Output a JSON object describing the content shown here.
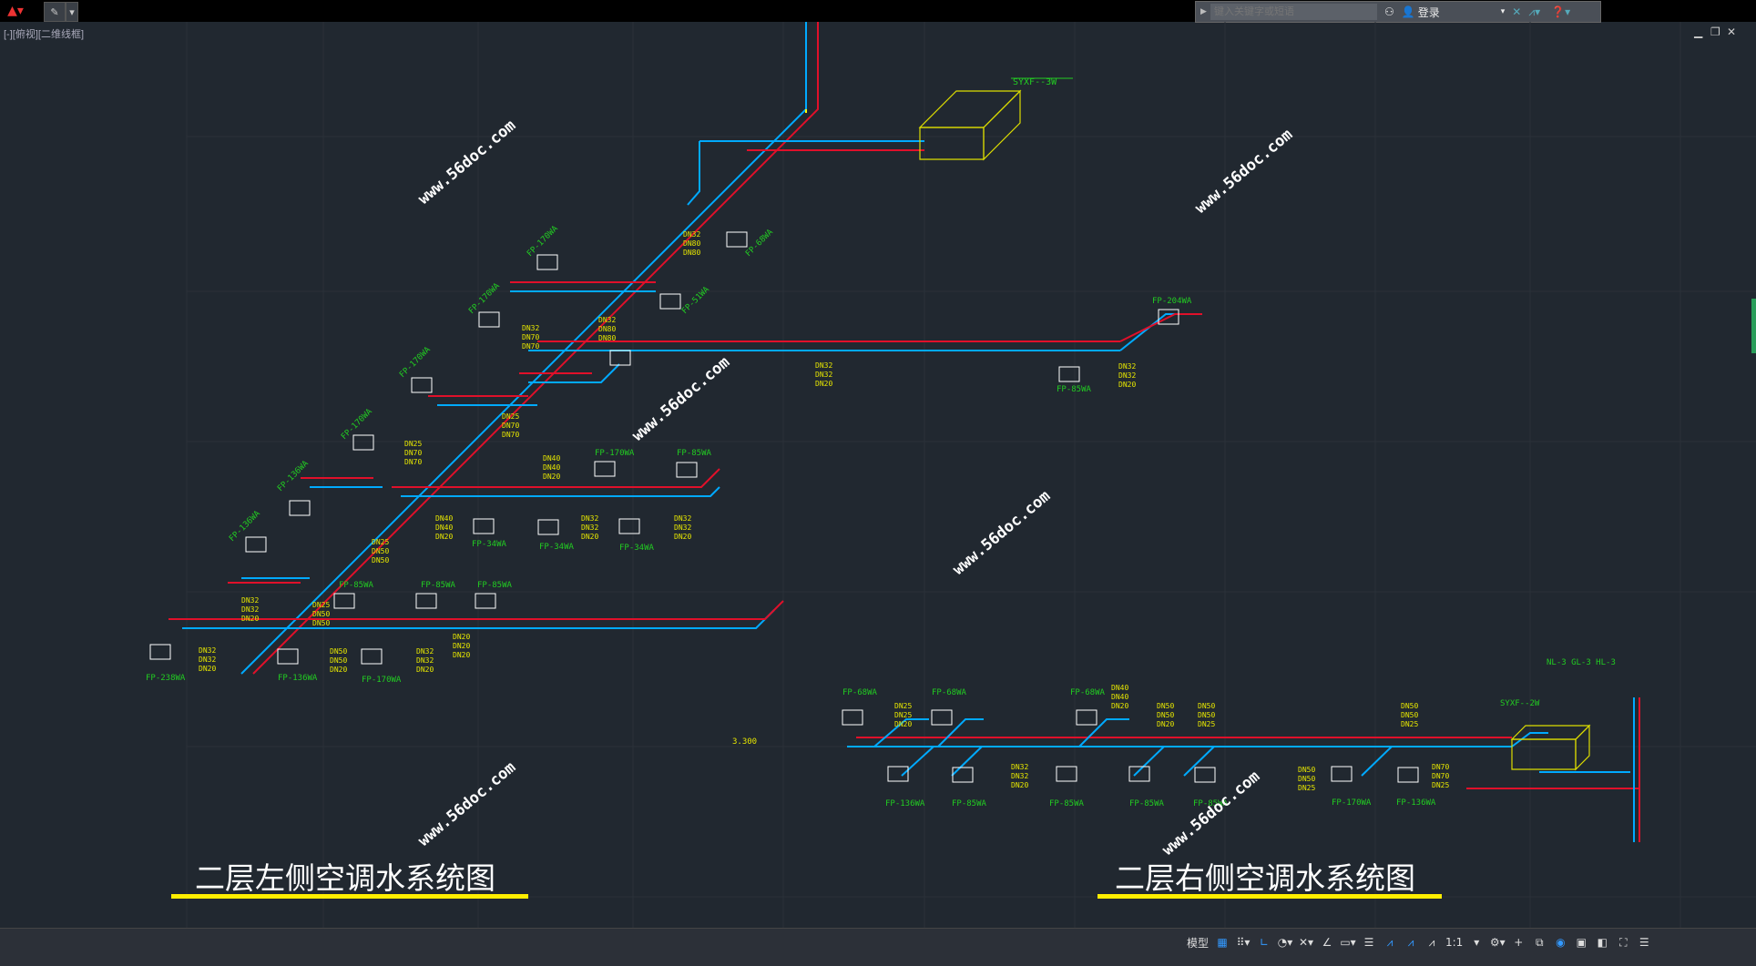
{
  "toolbar": {
    "search_placeholder": "键入关键字或短语",
    "login_label": "登录"
  },
  "viewport": {
    "label": "[-][俯视][二维线框]"
  },
  "drawing": {
    "title_left": "二层左侧空调水系统图",
    "title_right": "二层右侧空调水系统图",
    "watermark": "www.56doc.com",
    "equipment_top": "SYXF--3W",
    "equipment_right": "SYXF--2W",
    "riser_labels": "NL-3 GL-3 HL-3",
    "level_marker": "3.300",
    "units_left": [
      "FP-238WA",
      "FP-136WA",
      "FP-170WA",
      "FP-85WA",
      "FP-85WA",
      "FP-85WA",
      "FP-136WA",
      "FP-136WA",
      "FP-170WA",
      "FP-170WA",
      "FP-170WA",
      "FP-170WA",
      "FP-51WA",
      "FP-68WA",
      "FP-34WA",
      "FP-34WA",
      "FP-34WA",
      "FP-170WA",
      "FP-85WA"
    ],
    "units_top_right": [
      "FP-204WA",
      "FP-85WA"
    ],
    "units_bottom_right": [
      "FP-68WA",
      "FP-68WA",
      "FP-68WA",
      "FP-136WA",
      "FP-85WA",
      "FP-85WA",
      "FP-85WA",
      "FP-85WA",
      "FP-170WA",
      "FP-136WA"
    ],
    "pipe_tags": {
      "a": [
        "DN32",
        "DN32",
        "DN20"
      ],
      "b": [
        "DN25",
        "DN20",
        "DN20"
      ],
      "c": [
        "DN40",
        "DN40",
        "DN20"
      ],
      "d": [
        "DN50",
        "DN50",
        "DN20"
      ],
      "e": [
        "DN32",
        "DN80",
        "DN80"
      ],
      "f": [
        "DN32",
        "DN70",
        "DN70"
      ],
      "g": [
        "DN25",
        "DN70",
        "DN70"
      ]
    }
  },
  "statusbar": {
    "model_label": "模型",
    "scale_label": "1:1"
  }
}
